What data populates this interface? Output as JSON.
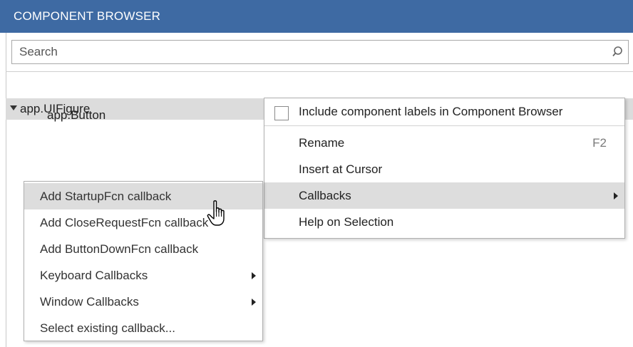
{
  "header": {
    "title": "COMPONENT BROWSER"
  },
  "search": {
    "placeholder": "Search",
    "icon": "search-icon"
  },
  "tree": {
    "root": {
      "label": "app.UIFigure",
      "expanded": true
    },
    "children": [
      {
        "label": "app.Button"
      }
    ]
  },
  "context_menu": {
    "include_labels": {
      "label": "Include component labels in Component Browser",
      "checked": false
    },
    "items": [
      {
        "label": "Rename",
        "shortcut": "F2"
      },
      {
        "label": "Insert at Cursor"
      },
      {
        "label": "Callbacks",
        "submenu": true,
        "highlighted": true
      },
      {
        "label": "Help on Selection"
      }
    ]
  },
  "callbacks_submenu": {
    "items": [
      {
        "label": "Add StartupFcn callback",
        "highlighted": true
      },
      {
        "label": "Add CloseRequestFcn callback"
      },
      {
        "label": "Add ButtonDownFcn callback"
      },
      {
        "label": "Keyboard Callbacks",
        "submenu": true
      },
      {
        "label": "Window Callbacks",
        "submenu": true
      },
      {
        "label": "Select existing callback..."
      }
    ]
  },
  "colors": {
    "header_bg": "#3e6aa3",
    "highlight_bg": "#dddddd",
    "tree_selected_bg": "#dcdcdc"
  },
  "cursor": {
    "icon": "hand-pointer-icon"
  }
}
